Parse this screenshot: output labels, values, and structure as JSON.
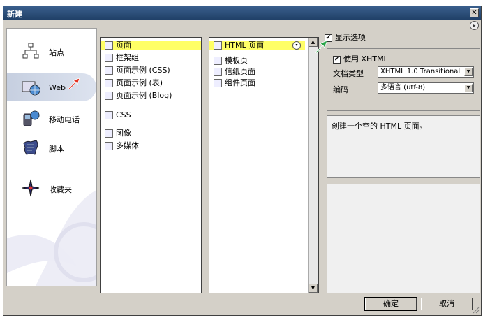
{
  "window": {
    "title": "新建",
    "close_label": "✕",
    "help_label": "▸"
  },
  "categories": [
    {
      "label": "站点",
      "icon": "site-icon"
    },
    {
      "label": "Web",
      "icon": "web-icon",
      "selected": true
    },
    {
      "label": "移动电话",
      "icon": "phone-icon"
    },
    {
      "label": "脚本",
      "icon": "script-icon"
    },
    {
      "label": "收藏夹",
      "icon": "favorites-icon"
    }
  ],
  "types": [
    {
      "label": "页面",
      "selected": true
    },
    {
      "label": "框架组"
    },
    {
      "label": "页面示例 (CSS)"
    },
    {
      "label": "页面示例 (表)"
    },
    {
      "label": "页面示例 (Blog)"
    },
    {
      "label": "CSS"
    },
    {
      "label": "图像"
    },
    {
      "label": "多媒体"
    }
  ],
  "templates": [
    {
      "label": "HTML 页面",
      "selected": true
    },
    {
      "label": "模板页"
    },
    {
      "label": "信纸页面"
    },
    {
      "label": "组件页面"
    }
  ],
  "options": {
    "show_options_label": "显示选项",
    "show_options_checked": "✔",
    "use_xhtml_label": "使用 XHTML",
    "use_xhtml_checked": "✔",
    "doctype_label": "文档类型",
    "doctype_value": "XHTML 1.0 Transitional",
    "encoding_label": "编码",
    "encoding_value": "多语言 (utf-8)"
  },
  "description": "创建一个空的 HTML 页面。",
  "buttons": {
    "ok": "确定",
    "cancel": "取消"
  },
  "colors": {
    "selection": "#ffff66",
    "titlebar": "#1f3f66",
    "dialog": "#d4d0c8"
  }
}
